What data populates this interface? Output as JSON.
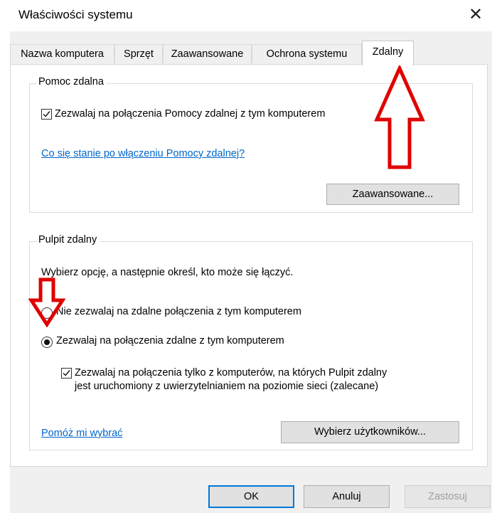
{
  "window": {
    "title": "Właściwości systemu",
    "close_icon": "close-icon"
  },
  "tabs": [
    {
      "label": "Nazwa komputera",
      "active": false
    },
    {
      "label": "Sprzęt",
      "active": false
    },
    {
      "label": "Zaawansowane",
      "active": false
    },
    {
      "label": "Ochrona systemu",
      "active": false
    },
    {
      "label": "Zdalny",
      "active": true
    }
  ],
  "remote_assistance": {
    "group_label": "Pomoc zdalna",
    "allow_checkbox_label": "Zezwalaj na połączenia Pomocy zdalnej z tym komputerem",
    "allow_checked": true,
    "help_link": "Co się stanie po włączeniu Pomocy zdalnej?",
    "advanced_button": "Zaawansowane..."
  },
  "remote_desktop": {
    "group_label": "Pulpit zdalny",
    "instruction": "Wybierz opcję, a następnie określ, kto może się łączyć.",
    "option_deny": "Nie zezwalaj na zdalne połączenia z tym komputerem",
    "option_allow": "Zezwalaj na połączenia zdalne z tym komputerem",
    "selected": "allow",
    "nla_line1": "Zezwalaj na połączenia tylko z komputerów, na których Pulpit zdalny",
    "nla_line2": "jest uruchomiony z uwierzytelnianiem na poziomie sieci (zalecane)",
    "nla_checked": true,
    "help_link": "Pomóż mi wybrać",
    "select_users_button": "Wybierz użytkowników..."
  },
  "footer": {
    "ok": "OK",
    "cancel": "Anuluj",
    "apply": "Zastosuj"
  },
  "annotations": {
    "arrow_color": "#e00000"
  }
}
